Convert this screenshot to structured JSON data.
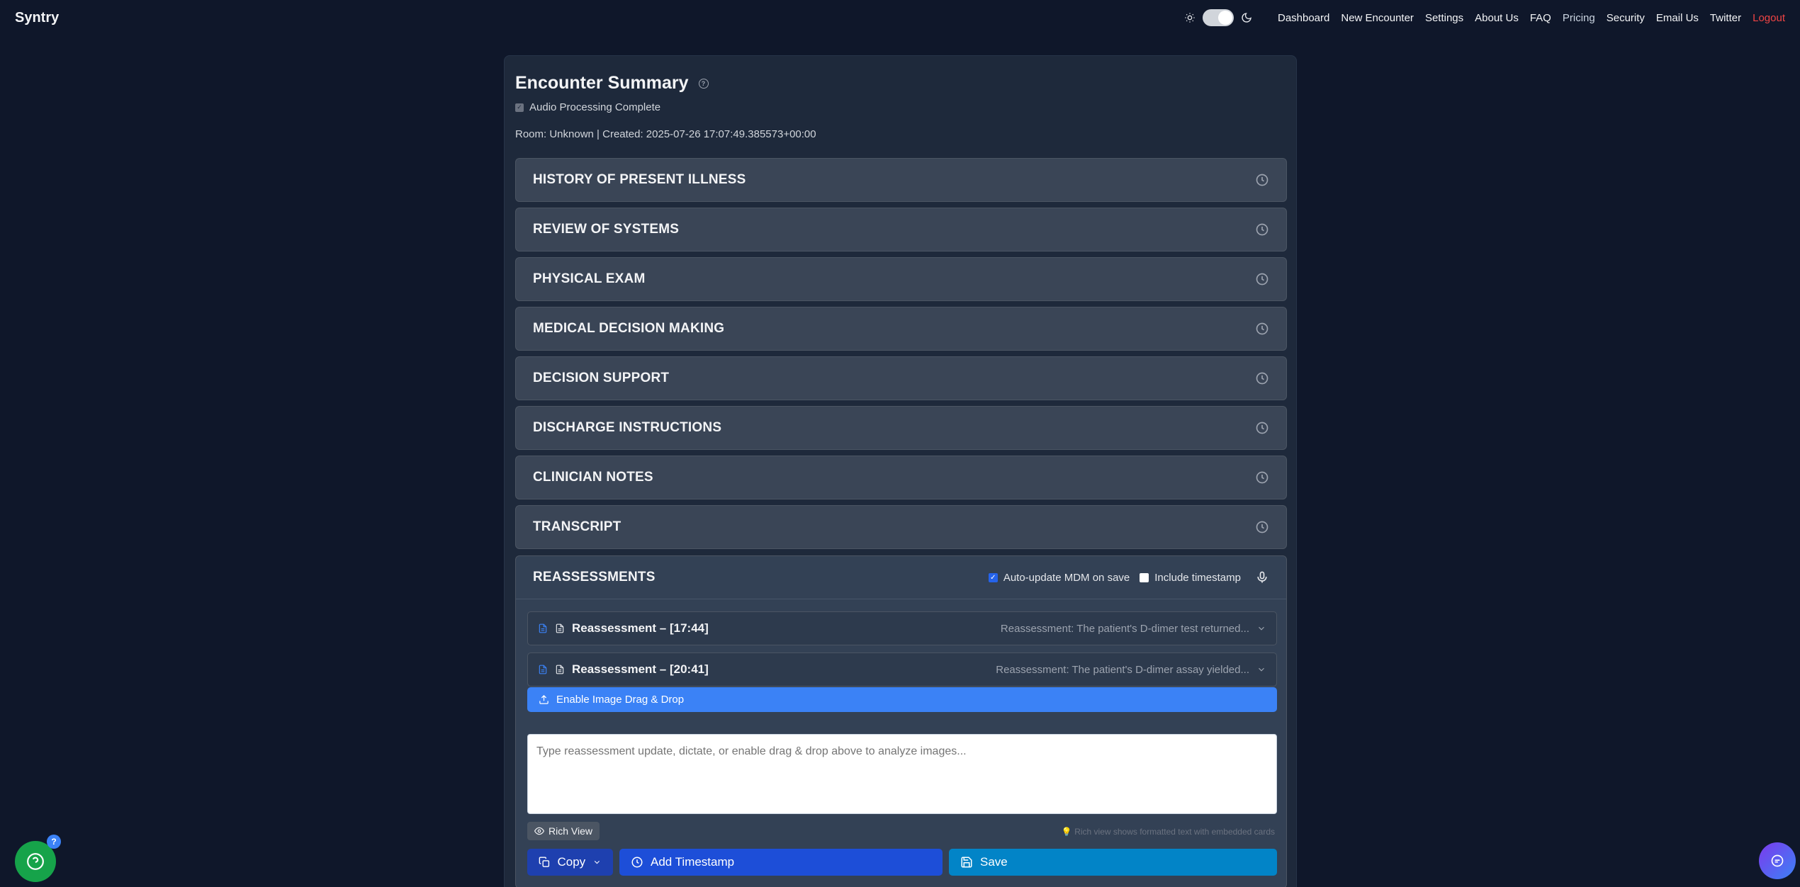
{
  "brand": "Syntry",
  "nav": {
    "links": [
      "Dashboard",
      "New Encounter",
      "Settings",
      "About Us",
      "FAQ",
      "Pricing",
      "Security",
      "Email Us",
      "Twitter",
      "Logout"
    ]
  },
  "summary": {
    "title": "Encounter Summary",
    "audio_status": "Audio Processing Complete",
    "meta": "Room: Unknown | Created: 2025-07-26 17:07:49.385573+00:00"
  },
  "sections": [
    "HISTORY OF PRESENT ILLNESS",
    "REVIEW OF SYSTEMS",
    "PHYSICAL EXAM",
    "MEDICAL DECISION MAKING",
    "DECISION SUPPORT",
    "DISCHARGE INSTRUCTIONS",
    "CLINICIAN NOTES",
    "TRANSCRIPT"
  ],
  "reassessments": {
    "title": "REASSESSMENTS",
    "auto_update_label": "Auto-update MDM on save",
    "auto_update_checked": true,
    "timestamp_label": "Include timestamp",
    "timestamp_checked": false,
    "entries": [
      {
        "title": "Reassessment – [17:44]",
        "preview": "Reassessment: The patient's D-dimer test returned..."
      },
      {
        "title": "Reassessment – [20:41]",
        "preview": "Reassessment: The patient's D-dimer assay yielded..."
      }
    ],
    "drag_drop_label": "Enable Image Drag & Drop",
    "input_placeholder": "Type reassessment update, dictate, or enable drag & drop above to analyze images...",
    "rich_view_label": "Rich View",
    "rich_view_hint": "💡 Rich view shows formatted text with embedded cards",
    "copy_label": "Copy",
    "add_timestamp_label": "Add Timestamp",
    "save_label": "Save"
  },
  "help_badge": "?"
}
